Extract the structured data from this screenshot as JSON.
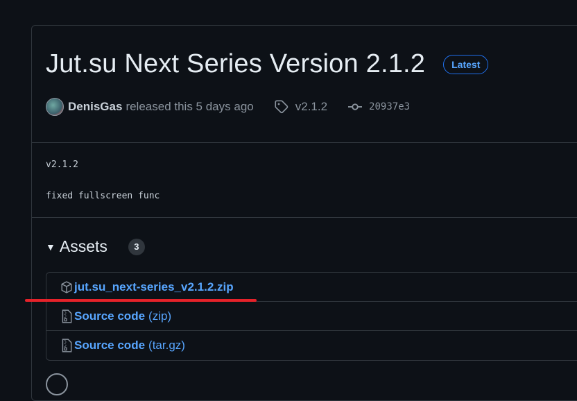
{
  "release": {
    "title": "Jut.su Next Series Version 2.1.2",
    "badge": "Latest",
    "author": "DenisGas",
    "released_text": "released this 5 days ago",
    "tag": "v2.1.2",
    "commit": "20937e3"
  },
  "notes": {
    "line1": "v2.1.2",
    "line2": "fixed fullscreen func"
  },
  "assets": {
    "title": "Assets",
    "count": "3",
    "items": [
      {
        "label": "jut.su_next-series_v2.1.2.zip",
        "ext": "",
        "icon": "package-icon"
      },
      {
        "label": "Source code",
        "ext": "(zip)",
        "icon": "file-zip-icon"
      },
      {
        "label": "Source code",
        "ext": "(tar.gz)",
        "icon": "file-zip-icon"
      }
    ]
  },
  "colors": {
    "background": "#0d1117",
    "border": "#30363d",
    "link": "#58a6ff",
    "annotation_red": "#e5222a"
  }
}
